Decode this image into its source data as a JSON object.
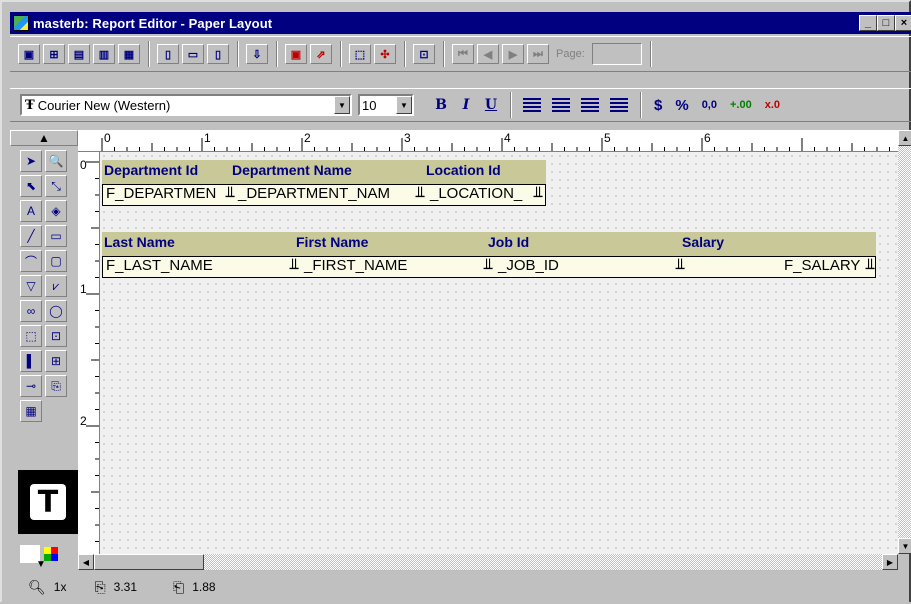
{
  "window": {
    "title": "masterb: Report Editor - Paper Layout"
  },
  "title_controls": {
    "minimize": "_",
    "restore": "□",
    "close": "×"
  },
  "toolbar1": {
    "page_label": "Page:",
    "icons": [
      "report-icon",
      "data-model-icon",
      "layout-model-icon",
      "live-previewer-icon",
      "parameter-form-icon",
      "header-section-icon",
      "main-section-icon",
      "trailer-section-icon",
      "field-flow-icon",
      "confine-mode-icon",
      "flex-mode-icon",
      "select-parent-icon",
      "group-frame-icon",
      "align-icon",
      "first-page-icon",
      "previous-page-icon",
      "next-page-icon",
      "last-page-icon"
    ]
  },
  "toolbar2": {
    "font_name": "Courier New (Western)",
    "font_size": "10",
    "bold": "B",
    "italic": "I",
    "underline": "U",
    "currency": "$",
    "percent": "%",
    "commas": "0,0",
    "add_decimal": "+.00",
    "remove_decimal": "x.0"
  },
  "palette": {
    "big_tool": "T"
  },
  "rulers": {
    "horizontal": [
      "0",
      "1",
      "2",
      "3",
      "4",
      "5",
      "6"
    ],
    "vertical": [
      "0",
      "1",
      "2"
    ]
  },
  "layout": {
    "dept_headers": [
      "Department Id",
      "Department Name",
      "Location Id"
    ],
    "dept_fields": [
      "F_DEPARTMENT",
      "F_DEPARTMENT_NAME",
      "F_LOCATION_ID"
    ],
    "dept_fields_display": [
      "F_DEPARTMEN",
      "_DEPARTMENT_NAM",
      "_LOCATION_"
    ],
    "emp_headers": [
      "Last Name",
      "First Name",
      "Job Id",
      "Salary"
    ],
    "emp_fields": [
      "F_LAST_NAME",
      "F_FIRST_NAME",
      "F_JOB_ID",
      "F_SALARY"
    ],
    "emp_fields_display": [
      "F_LAST_NAME",
      "_FIRST_NAME",
      "_JOB_ID",
      "F_SALARY"
    ]
  },
  "status": {
    "zoom": "1x",
    "x": "3.31",
    "y": "1.88"
  },
  "colors": {
    "titlebar": "#000080",
    "label_text": "#000080",
    "header_band": "#c8c898",
    "field_bg": "#fbfbe8"
  }
}
